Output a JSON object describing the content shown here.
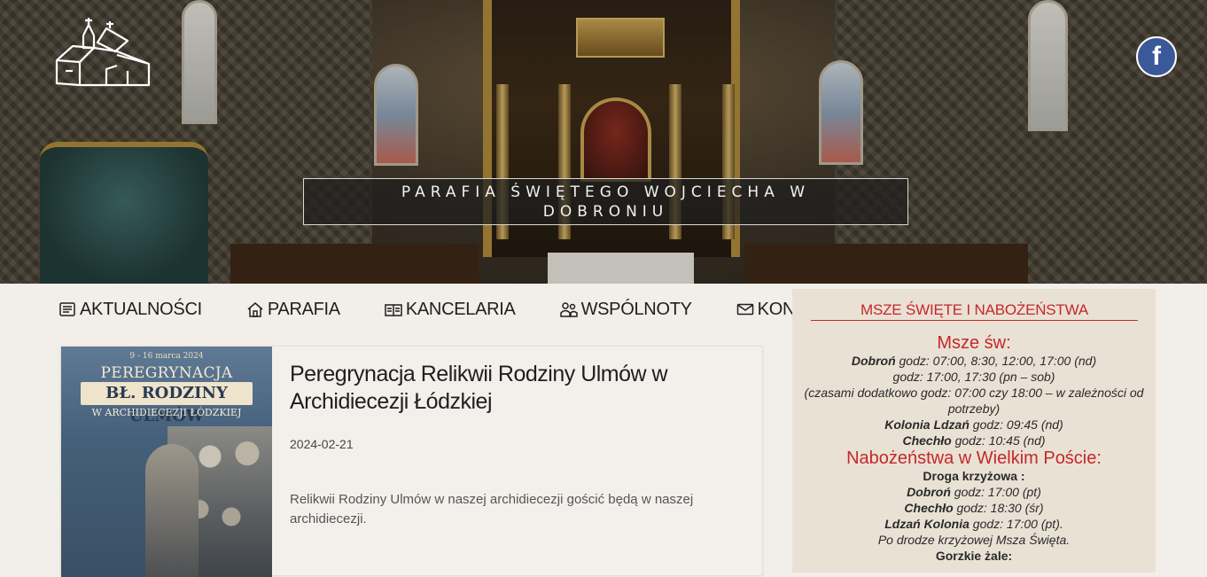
{
  "site": {
    "title": "PARAFIA ŚWIĘTEGO WOJCIECHA W DOBRONIU",
    "logo_icon": "church-logo-icon",
    "facebook_icon": "facebook-icon",
    "facebook_glyph": "f"
  },
  "nav": {
    "items": [
      {
        "label": "AKTUALNOŚCI",
        "icon": "newspaper-icon"
      },
      {
        "label": "PARAFIA",
        "icon": "home-icon"
      },
      {
        "label": "KANCELARIA",
        "icon": "book-icon"
      },
      {
        "label": "WSPÓLNOTY",
        "icon": "people-icon"
      },
      {
        "label": "KONTAKT",
        "icon": "envelope-icon"
      }
    ]
  },
  "article": {
    "title": "Peregrynacja Relikwii Rodziny Ulmów w Archidiecezji Łódzkiej",
    "date": "2024-02-21",
    "excerpt": "Relikwii Rodziny Ulmów w naszej archidiecezji gościć będą w naszej archidiecezji.",
    "poster": {
      "date": "9 - 16 marca 2024",
      "line1": "PEREGRYNACJA RELIKWII",
      "line2": "BŁ. RODZINY ULMÓW",
      "line3": "W ARCHIDIECEZJI ŁÓDZKIEJ"
    }
  },
  "sidebar": {
    "title": "MSZE ŚWIĘTE I NABOŻEŃSTWA",
    "masses_heading": "Msze św:",
    "line1_place": "Dobroń",
    "line1_rest": " godz: 07:00, 8:30, 12:00, 17:00 (nd)",
    "line2": "godz: 17:00, 17:30 (pn – sob)",
    "line3": "(czasami dodatkowo godz: 07:00 czy 18:00 – w zależności od potrzeby)",
    "line4_place": "Kolonia Ldzań",
    "line4_rest": " godz: 09:45 (nd)",
    "line5_place": "Chechło",
    "line5_rest": " godz: 10:45 (nd)",
    "lent_heading": "Nabożeństwa w Wielkim Poście:",
    "way_heading": "Droga krzyżowa :",
    "way1_place": "Dobroń",
    "way1_rest": " godz: 17:00 (pt)",
    "way2_place": "Chechło",
    "way2_rest": " godz: 18:30 (śr)",
    "way3_place": "Ldzań Kolonia",
    "way3_rest": " godz: 17:00 (pt).",
    "way_note": "Po drodze krzyżowej Msza Święta.",
    "lament_heading": "Gorzkie żale:"
  }
}
